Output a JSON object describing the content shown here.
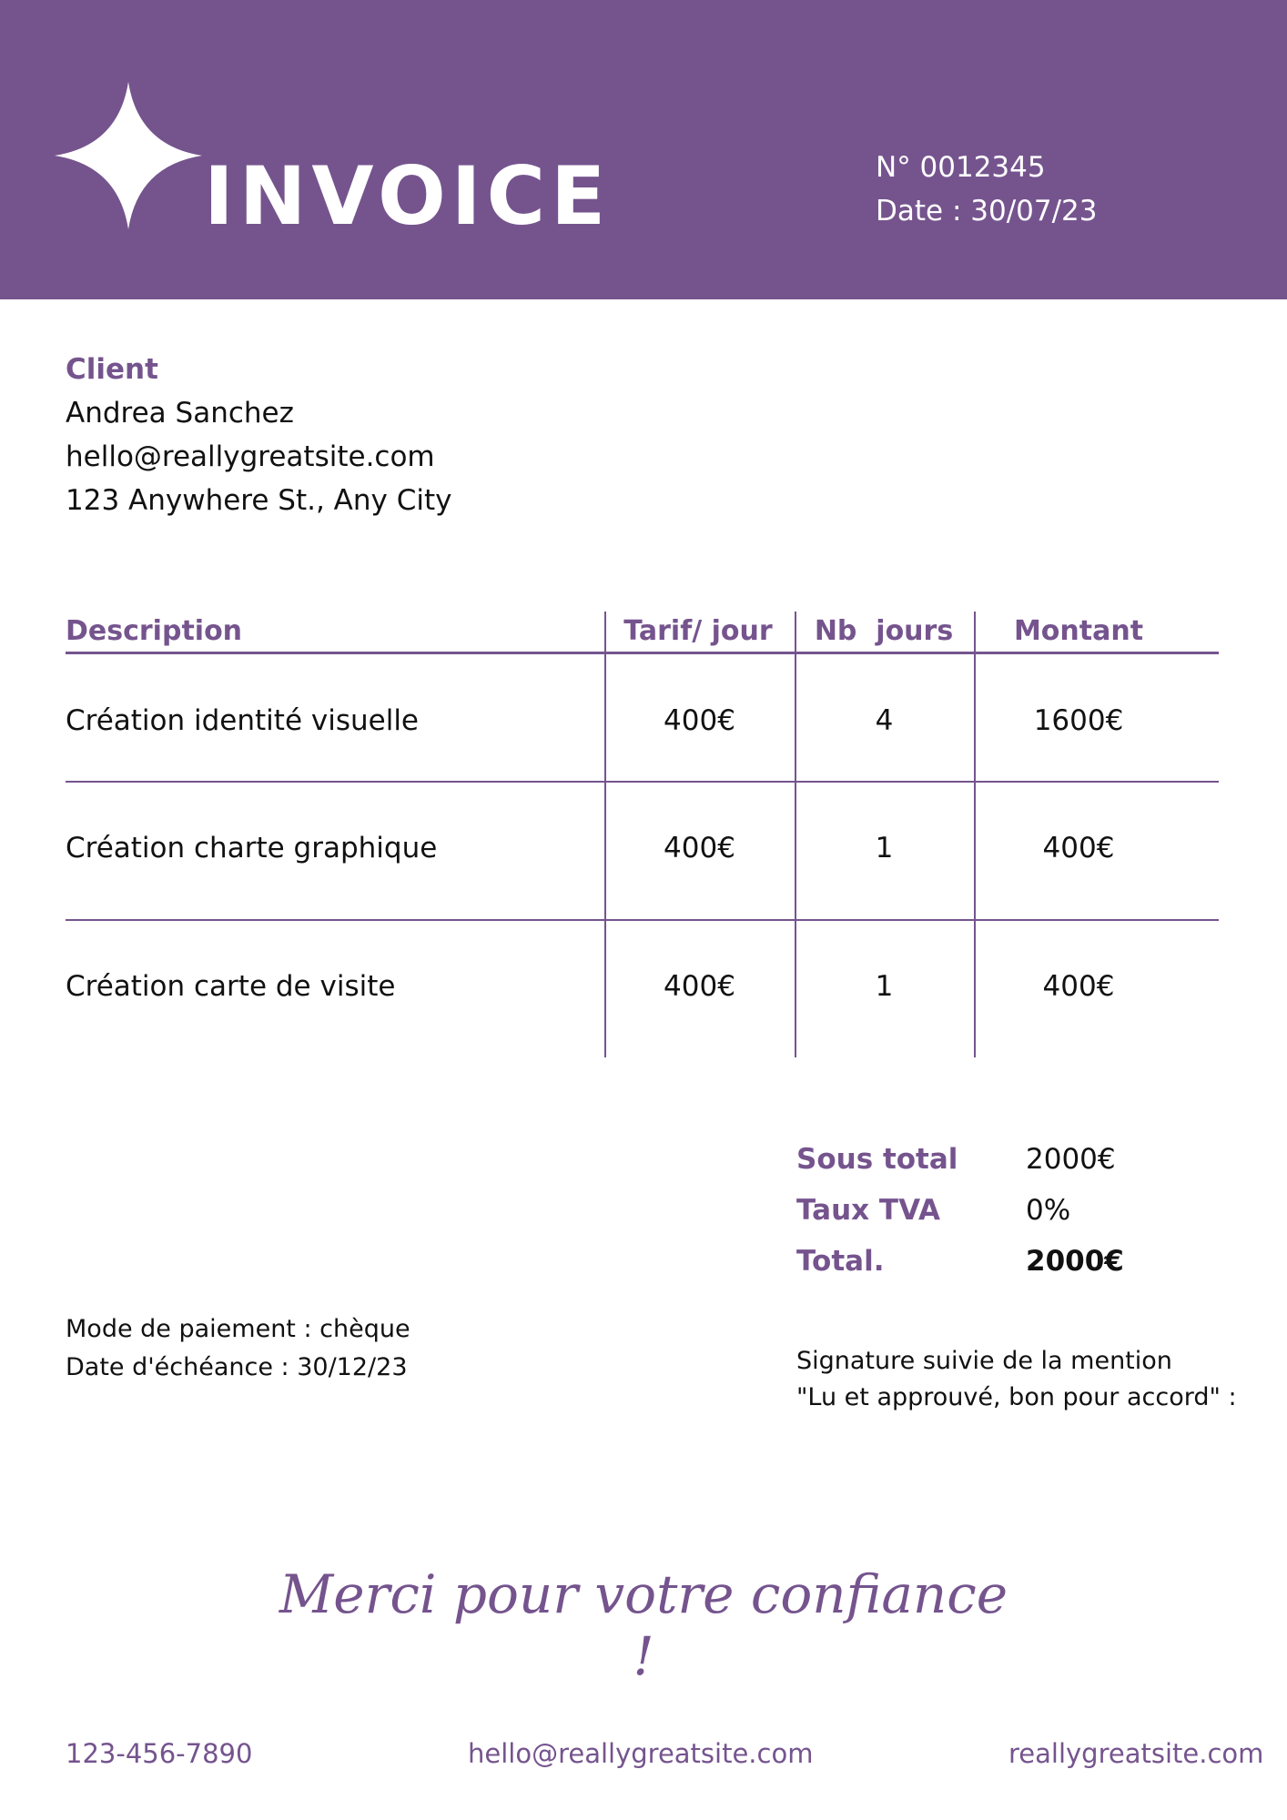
{
  "header": {
    "title": "INVOICE",
    "number": "N° 0012345",
    "date": "Date : 30/07/23",
    "icon": "four-point-star-icon",
    "accent_color": "#75548e"
  },
  "client": {
    "heading": "Client",
    "name": "Andrea Sanchez",
    "email": "hello@reallygreatsite.com",
    "address": "123 Anywhere St., Any City"
  },
  "table": {
    "headers": [
      "Description",
      "Tarif/ jour",
      "Nb  jours",
      "Montant"
    ],
    "rows": [
      [
        "Création identité visuelle",
        "400€",
        "4",
        "1600€"
      ],
      [
        "Création charte graphique",
        "400€",
        "1",
        "400€"
      ],
      [
        "Création carte de visite",
        "400€",
        "1",
        "400€"
      ]
    ]
  },
  "totals": {
    "subtotal_label": "Sous total",
    "subtotal_value": "2000€",
    "tax_label": "Taux TVA",
    "tax_value": "0%",
    "total_label": "Total.",
    "total_value": "2000€"
  },
  "payment": {
    "method": "Mode de paiement : chèque",
    "due_date": "Date d'échéance : 30/12/23"
  },
  "signature": {
    "line1": "Signature suivie de la mention",
    "line2": "\"Lu et approuvé, bon pour accord\" :"
  },
  "thanks": "Merci pour votre confiance !",
  "footer": {
    "phone": "123-456-7890",
    "email": "hello@reallygreatsite.com",
    "website": "reallygreatsite.com"
  }
}
